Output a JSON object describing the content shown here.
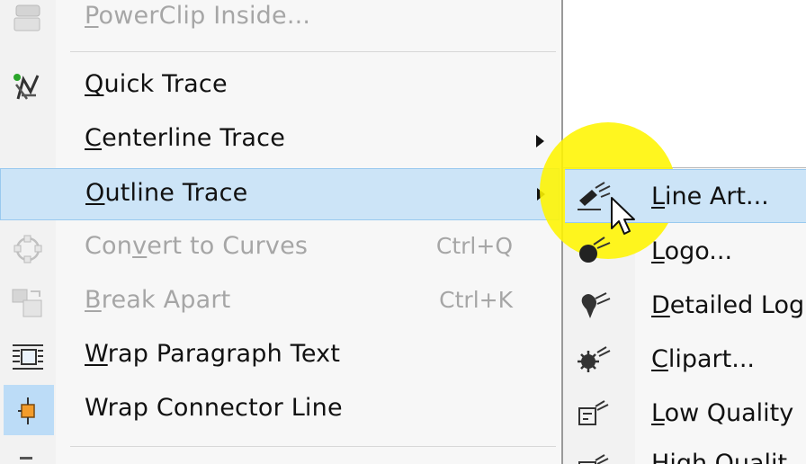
{
  "main_menu": {
    "items": [
      {
        "label": "PowerClip Inside...",
        "mnemonic": "P",
        "rest": "owerClip Inside...",
        "shortcut": "",
        "icon": "powerclip-icon",
        "disabled": true,
        "submenu": false,
        "highlighted": false
      },
      {
        "label": "Quick Trace",
        "mnemonic": "Q",
        "rest": "uick Trace",
        "shortcut": "",
        "icon": "quick-trace-icon",
        "disabled": false,
        "submenu": false,
        "highlighted": false
      },
      {
        "label": "Centerline Trace",
        "mnemonic": "C",
        "rest": "enterline Trace",
        "shortcut": "",
        "icon": "",
        "disabled": false,
        "submenu": true,
        "highlighted": false
      },
      {
        "label": "Outline Trace",
        "mnemonic": "O",
        "rest": "utline Trace",
        "shortcut": "",
        "icon": "",
        "disabled": false,
        "submenu": true,
        "highlighted": true
      },
      {
        "label": "Convert to Curves",
        "pre": "Con",
        "mnemonic": "v",
        "rest": "ert to Curves",
        "shortcut": "Ctrl+Q",
        "icon": "convert-to-curves-icon",
        "disabled": true,
        "submenu": false,
        "highlighted": false
      },
      {
        "label": "Break Apart",
        "mnemonic": "B",
        "rest": "reak Apart",
        "shortcut": "Ctrl+K",
        "icon": "break-apart-icon",
        "disabled": true,
        "submenu": false,
        "highlighted": false
      },
      {
        "label": "Wrap Paragraph Text",
        "mnemonic": "W",
        "rest": "rap Paragraph Text",
        "shortcut": "",
        "icon": "wrap-paragraph-text-icon",
        "disabled": false,
        "submenu": false,
        "highlighted": false
      },
      {
        "label": "Wrap Connector Line",
        "mnemonic": "",
        "rest": "Wrap Connector Line",
        "shortcut": "",
        "icon": "wrap-connector-line-icon",
        "disabled": false,
        "submenu": false,
        "highlighted": false
      }
    ]
  },
  "outline_trace_submenu": {
    "items": [
      {
        "label": "Line Art...",
        "mnemonic": "L",
        "rest": "ine Art...",
        "icon": "line-art-icon",
        "highlighted": true
      },
      {
        "label": "Logo...",
        "mnemonic": "L",
        "rest": "ogo...",
        "icon": "logo-icon",
        "highlighted": false
      },
      {
        "label": "Detailed Log",
        "mnemonic": "D",
        "rest": "etailed Log",
        "icon": "detailed-logo-icon",
        "highlighted": false
      },
      {
        "label": "Clipart...",
        "mnemonic": "C",
        "rest": "lipart...",
        "icon": "clipart-icon",
        "highlighted": false
      },
      {
        "label": "Low Quality",
        "mnemonic": "L",
        "rest": "ow Quality",
        "icon": "low-quality-image-icon",
        "highlighted": false
      },
      {
        "label": "High Qualit",
        "mnemonic": "H",
        "rest": "igh Qualit",
        "icon": "high-quality-image-icon",
        "highlighted": false
      }
    ]
  },
  "colors": {
    "highlight": "#cce4f7",
    "highlight_border": "#99c9ef",
    "disabled_text": "#a6a6a6",
    "cursor_spotlight": "#fff500"
  }
}
